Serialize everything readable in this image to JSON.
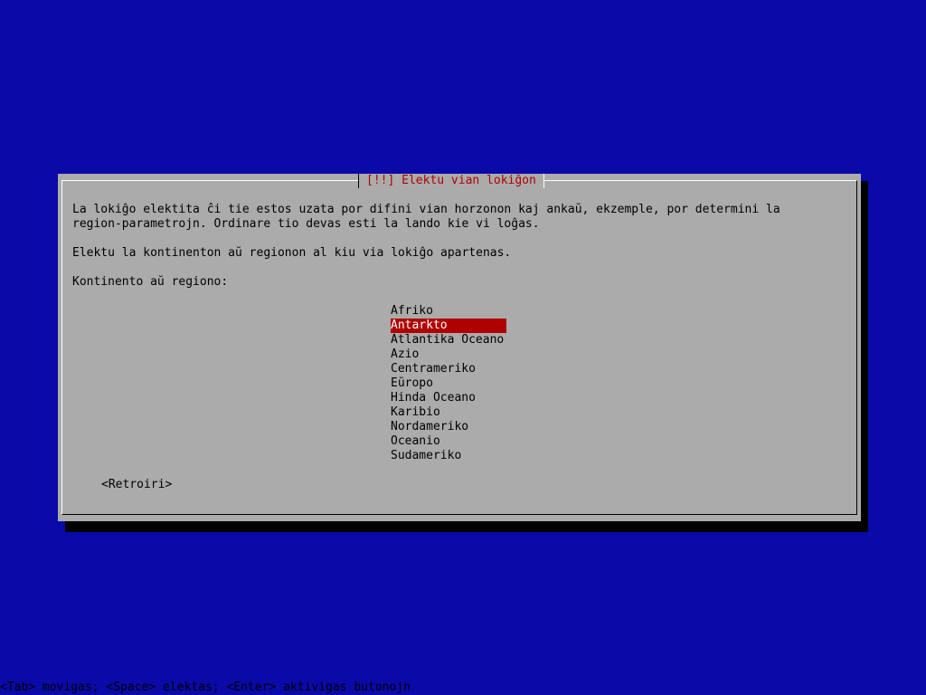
{
  "dialog": {
    "title": "[!!] Elektu vian lokiĝon",
    "description_line1": "La lokiĝo elektita ĉi tie estos uzata por difini vian horzonon kaj ankaŭ, ekzemple, por determini la",
    "description_line2": "region-parametrojn. Ordinare tio devas esti la lando kie vi loĝas.",
    "instruction": "Elektu la kontinenton aŭ regionon al kiu via lokiĝo apartenas.",
    "list_label": "Kontinento aŭ regiono:",
    "selected_index": 1,
    "options": [
      "Afriko",
      "Antarkto",
      "Atlantika Oceano",
      "Azio",
      "Centrameriko",
      "Eŭropo",
      "Hinda Oceano",
      "Karibio",
      "Nordameriko",
      "Oceanio",
      "Sudameriko"
    ],
    "back_button": "<Retroiri>"
  },
  "status_bar": "<Tab> movigas; <Space> elektas; <Enter> aktivigas butonojn",
  "colors": {
    "background": "#0a0aa8",
    "dialog": "#ababab",
    "accent": "#b00000"
  }
}
